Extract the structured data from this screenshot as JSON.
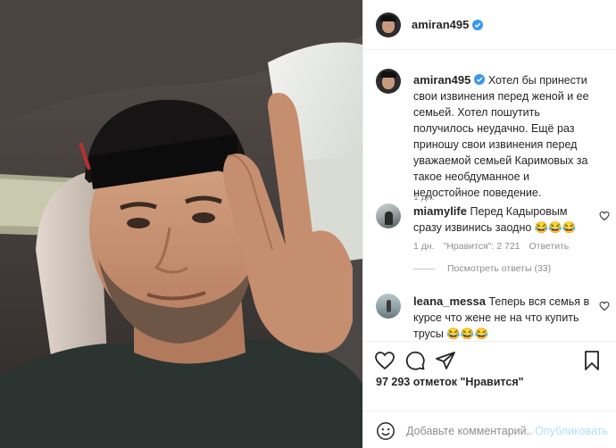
{
  "post": {
    "author": "amiran495",
    "verified": true,
    "caption": "Хотел бы принести свои извинения перед женой и ее семьей. Хотел пошутить получилось неудачно. Ещё раз приношу свои извинения перед уважаемой семьей Каримовых за такое необдуманное и недостойное поведение.",
    "time": "1 дн."
  },
  "comments": [
    {
      "user": "miamylife",
      "text": "Перед Кадыровым сразу извинись заодно 😂😂😂",
      "time": "1 дн.",
      "likes_label": "\"Нравится\": 2 721",
      "reply_label": "Ответить",
      "view_replies": "Посмотреть ответы (33)"
    },
    {
      "user": "leana_messa",
      "text": "Теперь вся семья в курсе что жене не на что купить трусы 😂😂😂"
    }
  ],
  "likes_count": "97 293 отметок \"Нравится\"",
  "composer": {
    "placeholder": "Добавьте комментарий...",
    "publish_label": "Опубликовать"
  },
  "colors": {
    "verified": "#3897f0",
    "text": "#262626",
    "muted": "#8e8e8e",
    "publish_disabled": "#b2dffc"
  },
  "icons": [
    "heart-icon",
    "comment-icon",
    "share-icon",
    "bookmark-icon",
    "emoji-icon",
    "verified-icon"
  ]
}
